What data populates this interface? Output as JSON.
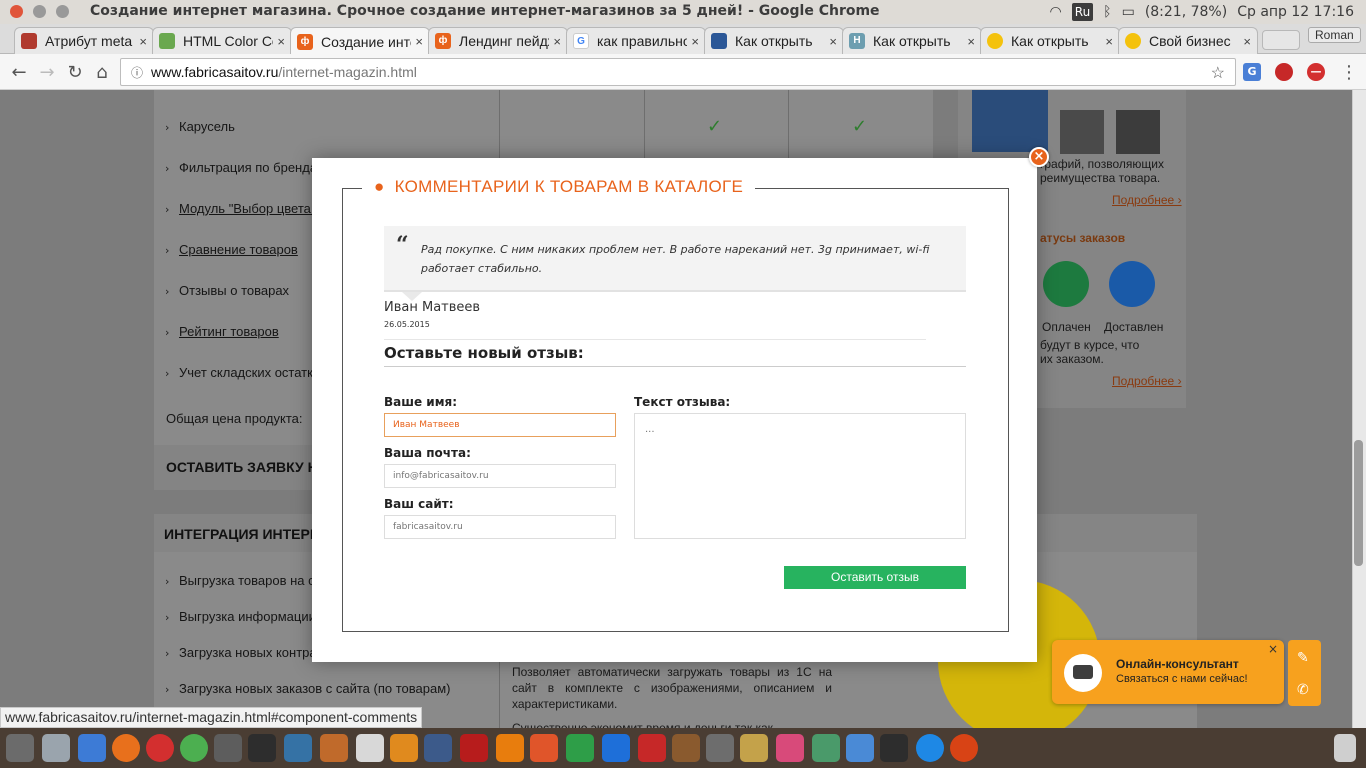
{
  "os": {
    "window_title": "Создание интернет магазина. Срочное создание интернет-магазинов за 5 дней! - Google Chrome",
    "keyboard_layout": "Ru",
    "battery": "(8:21, 78%)",
    "datetime": "Ср апр 12 17:16"
  },
  "browser": {
    "profile_name": "Roman",
    "tabs": [
      {
        "label": "Атрибут meta",
        "icon": "ext-favicon",
        "active": false
      },
      {
        "label": "HTML Color Codes",
        "icon": "grid-favicon",
        "active": false
      },
      {
        "label": "Создание интернет",
        "icon": "f-favicon",
        "active": true
      },
      {
        "label": "Лендинг пейдж",
        "icon": "f-favicon",
        "active": false
      },
      {
        "label": "как правильно",
        "icon": "google-favicon",
        "active": false
      },
      {
        "label": "Как открыть",
        "icon": "site-favicon",
        "active": false
      },
      {
        "label": "Как открыть",
        "icon": "h-favicon",
        "active": false
      },
      {
        "label": "Как открыть",
        "icon": "circle-favicon",
        "active": false
      },
      {
        "label": "Свой бизнес",
        "icon": "circle-favicon",
        "active": false
      }
    ],
    "tab_close": "×",
    "url_host": "www.fabricasaitov.ru",
    "url_path": "/internet-magazin.html",
    "status_url": "www.fabricasaitov.ru/internet-magazin.html#component-comments"
  },
  "background_page": {
    "feature_rows": [
      {
        "label": "Карусель",
        "underline": false
      },
      {
        "label": "Фильтрация по брендам",
        "underline": false
      },
      {
        "label": "Модуль \"Выбор цвета и",
        "underline": true
      },
      {
        "label": "Сравнение товаров",
        "underline": true
      },
      {
        "label": "Отзывы о товарах",
        "underline": false
      },
      {
        "label": "Рейтинг товаров",
        "underline": true
      },
      {
        "label": "Учет складских остатков",
        "underline": false
      }
    ],
    "total_price_label": "Общая цена продукта:",
    "order_button": "ОСТАВИТЬ ЗАЯВКУ НА",
    "integration_title": "ИНТЕГРАЦИЯ ИНТЕРН",
    "integration_rows": [
      "Выгрузка товаров на са",
      "Выгрузка информации о",
      "Загрузка новых контра",
      "Загрузка новых заказов с сайта (по товарам)"
    ],
    "right_text_1a": "графий, позволяющих",
    "right_text_1b": "реимущества товара.",
    "more_link_1": "Подробнее ›",
    "order_status_title": "атусы заказов",
    "status_paid": "Оплачен",
    "status_delivered": "Доставлен",
    "right_text_2a": "будут в курсе, что",
    "right_text_2b": "их заказом.",
    "more_link_2": "Подробнее ›",
    "desc_1": "Позволяет автоматически загружать товары из 1С на сайт в комплекте с изображениями, описанием и характеристиками.",
    "desc_2": "Существенно экономит время и деньги так как"
  },
  "modal": {
    "title": "КОММЕНТАРИИ К ТОВАРАМ В КАТАЛОГЕ",
    "title_icon": "chat-bubbles-icon",
    "review_text": "Рад покупке. С ним никаких проблем нет. В работе нареканий нет. 3g принимает, wi-fi работает стабильно.",
    "review_author": "Иван Матвеев",
    "review_date": "26.05.2015",
    "new_review_heading": "Оставьте новый отзыв:",
    "name_label": "Ваше имя:",
    "name_value": "Иван Матвеев",
    "email_label": "Ваша почта:",
    "email_placeholder": "info@fabricasaitov.ru",
    "site_label": "Ваш сайт:",
    "site_placeholder": "fabricasaitov.ru",
    "text_label": "Текст отзыва:",
    "text_placeholder": "...",
    "submit_label": "Оставить отзыв",
    "close_label": "×",
    "accent_color": "#e8631c",
    "button_color": "#27b35f"
  },
  "chat_widget": {
    "title": "Онлайн-консультант",
    "subtitle": "Связаться с нами сейчас!",
    "close_label": "×"
  }
}
